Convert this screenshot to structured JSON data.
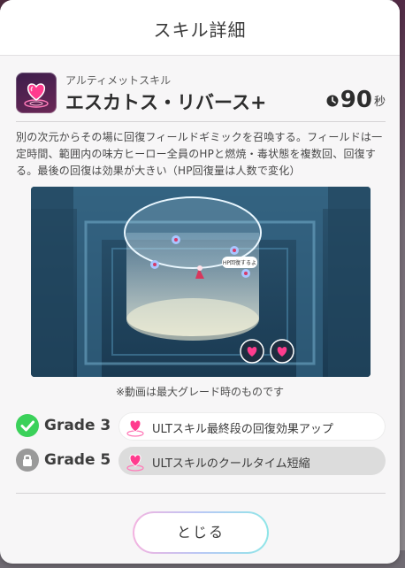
{
  "modal": {
    "title": "スキル詳細"
  },
  "skill": {
    "type": "アルティメットスキル",
    "name": "エスカトス・リバース",
    "name_suffix": "+",
    "cooldown_value": "90",
    "cooldown_unit": "秒",
    "icon": "heart-shield-icon",
    "description": "別の次元からその場に回復フィールドギミックを召喚する。フィールドは一定時間、範囲内の味方ヒーロー全員のHPと燃焼・毒状態を複数回、回復する。最後の回復は効果が大きい（HP回復量は人数で変化）"
  },
  "video": {
    "speech_bubble": "HP回復するよ",
    "note": "※動画は最大グレード時のものです"
  },
  "grades": [
    {
      "label": "Grade 3",
      "status": "unlocked",
      "status_icon": "check-circle-icon",
      "text": "ULTスキル最終段の回復効果アップ"
    },
    {
      "label": "Grade 5",
      "status": "locked",
      "status_icon": "lock-icon",
      "text": "ULTスキルのクールタイム短縮"
    }
  ],
  "buttons": {
    "close_label": "とじる"
  },
  "colors": {
    "accent_green": "#3bd15a",
    "locked_gray": "#9a9a9a",
    "pill_unlocked": "#ffffff",
    "pill_locked": "#dcdcdc",
    "icon_pink": "#ff3c8e"
  }
}
